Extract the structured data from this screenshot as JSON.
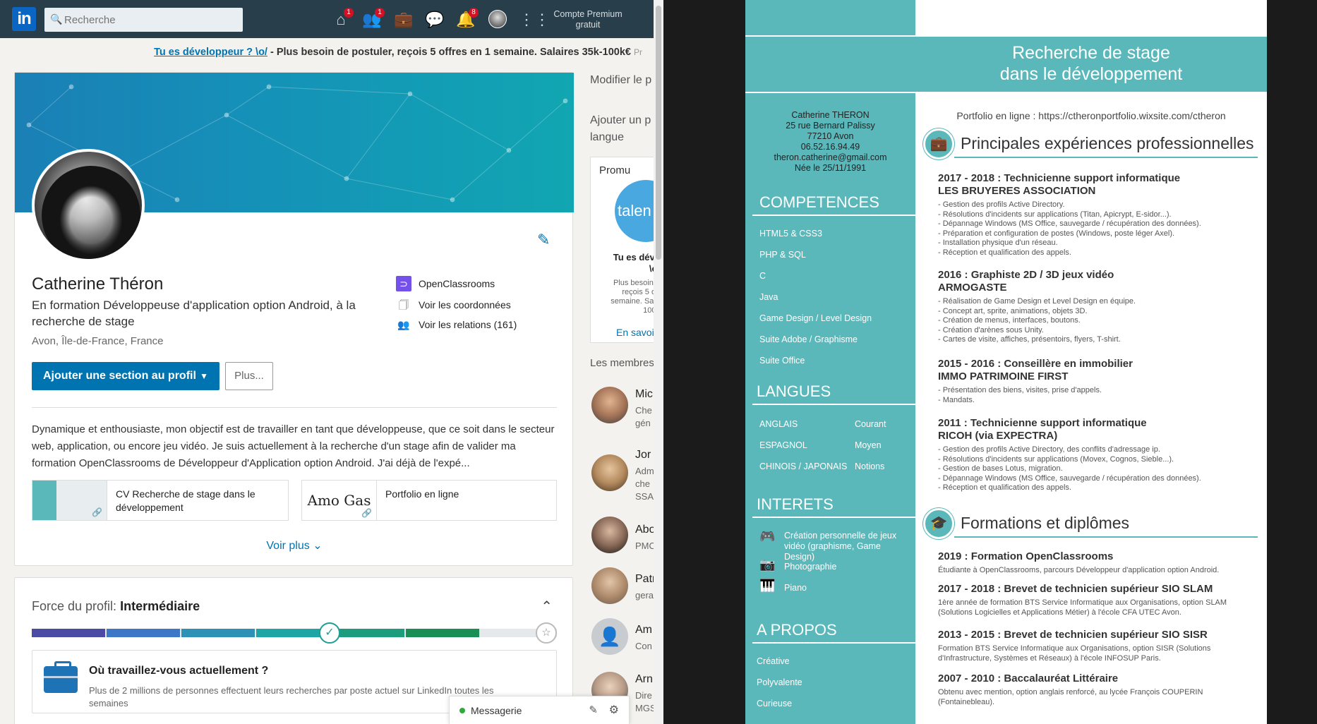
{
  "linkedin": {
    "search_placeholder": "Recherche",
    "nav_badges": [
      "1",
      "1",
      "8"
    ],
    "premium": "Compte Premium gratuit",
    "ad": {
      "link": "Tu es développeur ? \\o/",
      "text": " - Plus besoin de postuler, reçois 5 offres en 1 semaine. Salaires 35k-100k€",
      "suffix": "Pr"
    },
    "profile": {
      "name": "Catherine Théron",
      "headline": "En formation Développeuse d'application option Android, à la recherche de stage",
      "location": "Avon, Île-de-France, France",
      "school": "OpenClassrooms",
      "contact": "Voir les coordonnées",
      "connections": "Voir les relations (161)",
      "add_section": "Ajouter une section au profil",
      "more": "Plus...",
      "summary": "Dynamique et enthousiaste, mon objectif est de travailler en tant que développeuse, que ce soit dans le secteur web, application, ou encore jeu vidéo. Je suis actuellement à la recherche d'un stage afin de valider ma formation OpenClassrooms de Développeur d'Application option Android. J'ai déjà de l'expé...",
      "media": [
        {
          "title": "CV Recherche de stage dans le développement"
        },
        {
          "title": "Portfolio en ligne",
          "thumb_text": "Amo Gas"
        }
      ],
      "see_more": "Voir plus"
    },
    "strength": {
      "label": "Force du profil:",
      "level": "Intermédiaire",
      "progress": 0.6,
      "question": "Où travaillez-vous actuellement ?",
      "desc": "Plus de 2 millions de personnes effectuent leurs recherches par poste actuel sur LinkedIn toutes les semaines"
    },
    "right": {
      "edit": "Modifier le p",
      "add_line1": "Ajouter un p",
      "add_line2": "langue",
      "promo_label": "Promu",
      "promo_logo": "talen",
      "promo_title1": "Tu es déve",
      "promo_title2": "\\o/",
      "promo_desc": [
        "Plus besoin d",
        "reçois 5 off",
        "semaine. Sala",
        "100k"
      ],
      "promo_cta": "En savoi",
      "members": "Les membres",
      "people": [
        {
          "name": "Mic",
          "line1": "Che",
          "line2": "gén"
        },
        {
          "name": "Jor",
          "line1": "Adm",
          "line2": "che",
          "line3": "SSA"
        },
        {
          "name": "Abo",
          "line1": "PMC"
        },
        {
          "name": "Patr",
          "line1": "gera"
        },
        {
          "name": "Am",
          "line1": "Con"
        },
        {
          "name": "Arn",
          "line1": "Dire",
          "line2": "MGS"
        }
      ]
    },
    "messaging": "Messagerie"
  },
  "cv": {
    "title_line1": "Recherche de stage",
    "title_line2": "dans le développement",
    "contact": [
      "Catherine THERON",
      "25 rue Bernard Palissy",
      "77210 Avon",
      "06.52.16.94.49",
      "theron.catherine@gmail.com",
      "Née le 25/11/1991"
    ],
    "portfolio": "Portfolio en ligne : https://ctheronportfolio.wixsite.com/ctheron",
    "competences_title": "COMPETENCES",
    "competences": [
      "HTML5 & CSS3",
      "PHP & SQL",
      "C",
      "Java",
      "Game Design / Level Design",
      "Suite Adobe / Graphisme",
      "Suite Office"
    ],
    "langues_title": "LANGUES",
    "langues": [
      {
        "lang": "ANGLAIS",
        "level": "Courant"
      },
      {
        "lang": "ESPAGNOL",
        "level": "Moyen"
      },
      {
        "lang": "CHINOIS / JAPONAIS",
        "level": "Notions"
      }
    ],
    "interets_title": "INTERETS",
    "interets": [
      "Création personnelle de jeux vidéo (graphisme, Game Design)",
      "Photographie",
      "Piano"
    ],
    "apropos_title": "A PROPOS",
    "apropos": [
      "Créative",
      "Polyvalente",
      "Curieuse"
    ],
    "exp_title": "Principales expériences professionnelles",
    "jobs": [
      {
        "t1": "2017 - 2018 : Technicienne support informatique",
        "t2": "LES BRUYERES ASSOCIATION",
        "lines": [
          "- Gestion des profils Active Directory.",
          "- Résolutions d'incidents sur applications (Titan, Apicrypt, E-sidor...).",
          "- Dépannage Windows (MS Office, sauvegarde / récupération des données).",
          "- Préparation et configuration de postes (Windows, poste léger Axel).",
          "- Installation physique d'un réseau.",
          "- Réception et qualification des appels."
        ]
      },
      {
        "t1": "2016 : Graphiste 2D / 3D jeux vidéo",
        "t2": "ARMOGASTE",
        "lines": [
          "- Réalisation de Game Design et Level Design en équipe.",
          "- Concept art, sprite, animations, objets 3D.",
          "- Création de menus, interfaces, boutons.",
          "- Création d'arènes sous Unity.",
          "- Cartes de visite, affiches, présentoirs, flyers, T-shirt."
        ]
      },
      {
        "t1": "2015 - 2016 : Conseillère en immobilier",
        "t2": "IMMO PATRIMOINE FIRST",
        "lines": [
          "- Présentation des biens, visites, prise d'appels.",
          "- Mandats."
        ]
      },
      {
        "t1": "2011 : Technicienne support informatique",
        "t2": "RICOH (via EXPECTRA)",
        "lines": [
          "- Gestion des profils Active Directory, des conflits d'adressage ip.",
          "- Résolutions d'incidents sur applications (Movex, Cognos, Sieble...).",
          "- Gestion de bases Lotus, migration.",
          "- Dépannage Windows (MS Office, sauvegarde / récupération des données).",
          "- Réception et qualification des appels."
        ]
      }
    ],
    "form_title": "Formations et diplômes",
    "formations": [
      {
        "t": "2019 : Formation OpenClassrooms",
        "d": "Étudiante à OpenClassrooms, parcours Développeur d'application option Android."
      },
      {
        "t": "2017 - 2018 : Brevet de technicien supérieur SIO SLAM",
        "d": "1ère année de formation BTS Service Informatique aux Organisations, option SLAM (Solutions Logicielles et Applications Métier) à l'école CFA UTEC Avon."
      },
      {
        "t": "2013 - 2015 : Brevet de technicien supérieur SIO SISR",
        "d": "Formation BTS Service Informatique aux Organisations, option SISR (Solutions d'Infrastructure, Systèmes et Réseaux) à l'école INFOSUP Paris."
      },
      {
        "t": "2007 - 2010 : Baccalauréat Littéraire",
        "d": "Obtenu avec mention, option anglais renforcé, au lycée François COUPERIN (Fontainebleau)."
      }
    ]
  }
}
